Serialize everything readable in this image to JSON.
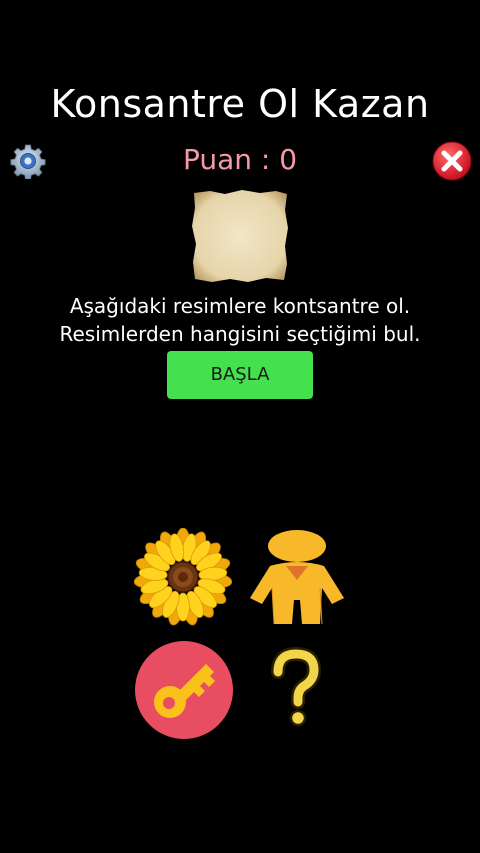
{
  "header": {
    "title": "Konsantre Ol Kazan",
    "score_label": "Puan : 0"
  },
  "icons": {
    "settings": "gear-icon",
    "close": "close-icon"
  },
  "instructions": {
    "line1": "Aşağıdaki resimlere kontsantre ol.",
    "line2": "Resimlerden hangisini seçtiğimi bul."
  },
  "start_button": {
    "label": "BAŞLA"
  },
  "colors": {
    "background": "#000000",
    "score": "#f59aa8",
    "start_button": "#44e04e",
    "close_button": "#e8192c",
    "key_circle": "#e84d61",
    "accent_yellow": "#f5c518"
  },
  "picture_options": [
    {
      "icon": "sunflower-icon"
    },
    {
      "icon": "person-icon"
    },
    {
      "icon": "key-icon"
    },
    {
      "icon": "question-mark-icon"
    }
  ]
}
